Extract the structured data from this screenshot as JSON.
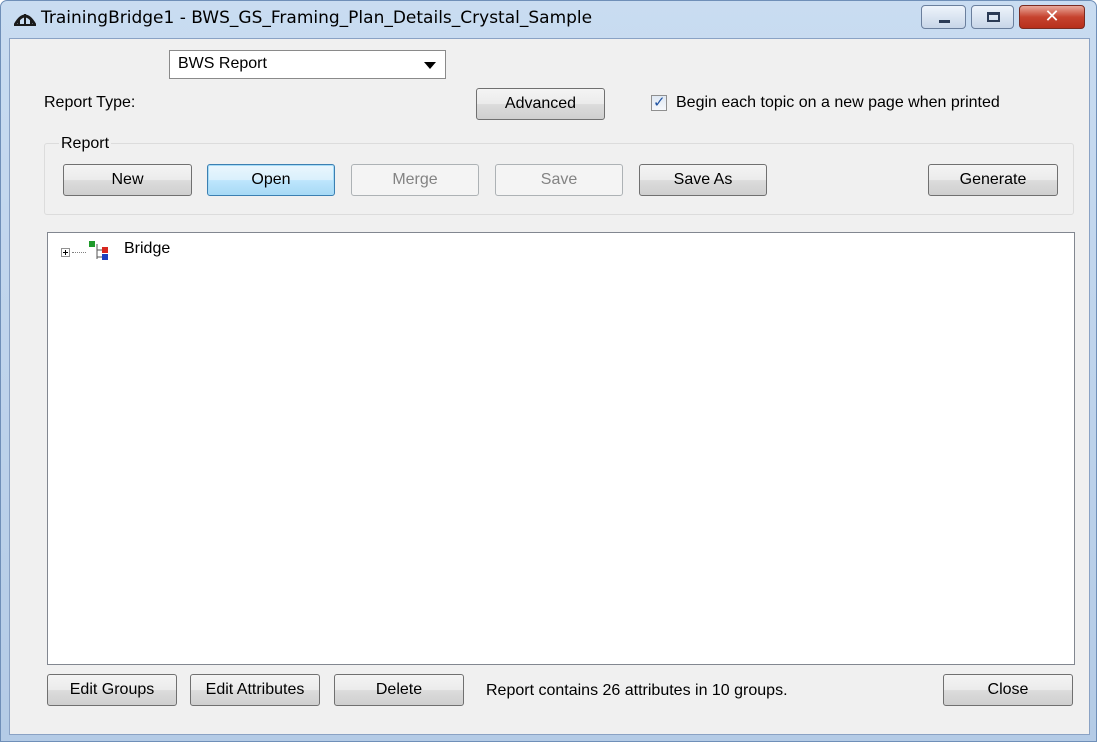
{
  "window": {
    "title": "TrainingBridge1 - BWS_GS_Framing_Plan_Details_Crystal_Sample",
    "colors": {
      "close_button": "#c6432f",
      "titlebar": "#c9dcf1",
      "focus": "#3c7fb1"
    }
  },
  "report_type": {
    "label": "Report Type:",
    "selected": "BWS Report",
    "advanced_label": "Advanced"
  },
  "print_option": {
    "label": "Begin each topic on a new page when printed",
    "checked": true
  },
  "report_group": {
    "legend": "Report",
    "buttons": {
      "new": "New",
      "open": "Open",
      "merge": "Merge",
      "save": "Save",
      "save_as": "Save As",
      "generate": "Generate"
    }
  },
  "tree": {
    "items": [
      {
        "label": "Bridge",
        "icon": "bridge-structure-icon",
        "expanded": false
      }
    ]
  },
  "footer": {
    "edit_groups": "Edit Groups",
    "edit_attributes": "Edit Attributes",
    "delete": "Delete",
    "status": "Report contains 26 attributes in 10 groups.",
    "close": "Close"
  }
}
